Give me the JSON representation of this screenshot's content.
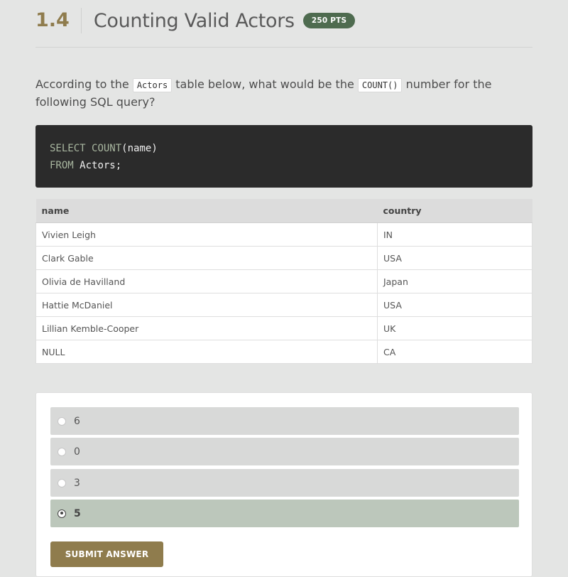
{
  "header": {
    "section_number": "1.4",
    "title": "Counting Valid Actors",
    "points_badge": "250 PTS"
  },
  "question": {
    "part1": "According to the ",
    "code1": "Actors",
    "part2": " table below, what would be the ",
    "code2": "COUNT()",
    "part3": " number for the following SQL query?"
  },
  "code": {
    "line1_kw1": "SELECT",
    "line1_kw2": "COUNT",
    "line1_rest": "(name)",
    "line2_kw": "FROM",
    "line2_rest": "Actors;"
  },
  "table": {
    "columns": [
      "name",
      "country"
    ],
    "rows": [
      [
        "Vivien Leigh",
        "IN"
      ],
      [
        "Clark Gable",
        "USA"
      ],
      [
        "Olivia de Havilland",
        "Japan"
      ],
      [
        "Hattie McDaniel",
        "USA"
      ],
      [
        "Lillian Kemble-Cooper",
        "UK"
      ],
      [
        "NULL",
        "CA"
      ]
    ]
  },
  "answers": {
    "options": [
      "6",
      "0",
      "3",
      "5"
    ],
    "selected_index": 3,
    "submit_label": "SUBMIT ANSWER"
  },
  "colors": {
    "accent_gold": "#8f7c4d",
    "badge_green": "#4e6b4f",
    "selected_option": "#bcc7bb"
  }
}
